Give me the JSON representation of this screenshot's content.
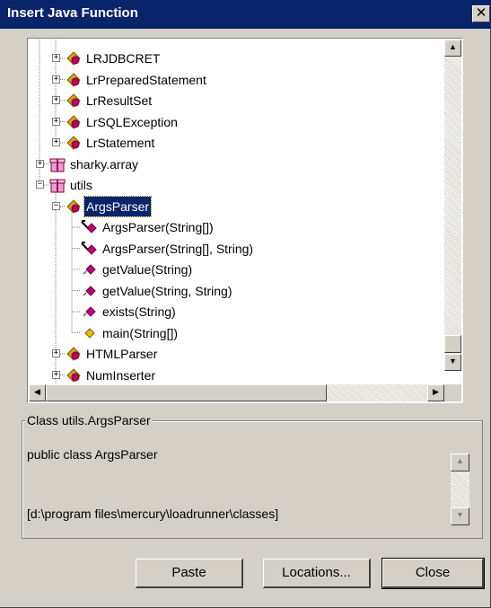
{
  "window": {
    "title": "Insert Java Function",
    "close_glyph": "✕"
  },
  "tree": {
    "rows": [
      {
        "label": "LRJDBCRET",
        "expander": "+",
        "icon": "java-class-icon"
      },
      {
        "label": "LrPreparedStatement",
        "expander": "+",
        "icon": "java-class-icon"
      },
      {
        "label": "LrResultSet",
        "expander": "+",
        "icon": "java-class-icon"
      },
      {
        "label": "LrSQLException",
        "expander": "+",
        "icon": "java-class-icon"
      },
      {
        "label": "LrStatement",
        "expander": "+",
        "icon": "java-class-icon"
      },
      {
        "label": "sharky.array",
        "expander": "+",
        "icon": "package-icon"
      },
      {
        "label": "utils",
        "expander": "−",
        "icon": "package-icon"
      },
      {
        "label": "ArgsParser",
        "expander": "−",
        "icon": "java-class-icon",
        "selected": true
      },
      {
        "label": "ArgsParser(String[])",
        "icon": "constructor-icon"
      },
      {
        "label": "ArgsParser(String[], String)",
        "icon": "constructor-icon"
      },
      {
        "label": "getValue(String)",
        "icon": "method-icon"
      },
      {
        "label": "getValue(String, String)",
        "icon": "method-icon"
      },
      {
        "label": "exists(String)",
        "icon": "method-icon"
      },
      {
        "label": "main(String[])",
        "icon": "static-method-icon"
      },
      {
        "label": "HTMLParser",
        "expander": "+",
        "icon": "java-class-icon"
      },
      {
        "label": "NumInserter",
        "expander": "+",
        "icon": "java-class-icon"
      }
    ]
  },
  "details": {
    "group_label": "Class utils.ArgsParser",
    "declaration": "public class ArgsParser",
    "path": "[d:\\program files\\mercury\\loadrunner\\classes]"
  },
  "buttons": {
    "paste": "Paste",
    "locations": "Locations...",
    "close": "Close"
  },
  "colors": {
    "title_bar": "#0a246a",
    "dialog_face": "#d4d0c8",
    "selection": "#0a246a"
  }
}
